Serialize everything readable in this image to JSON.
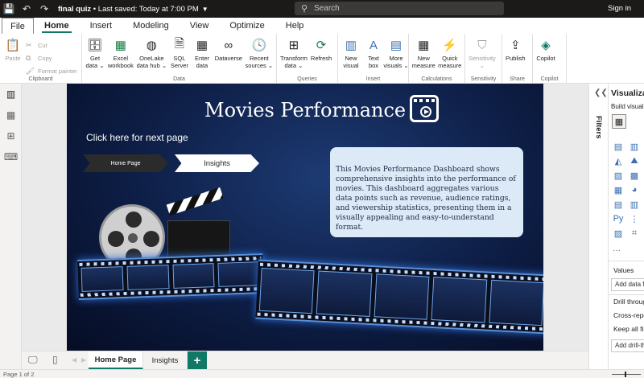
{
  "titlebar": {
    "file_name": "final quiz",
    "save_status": "Last saved: Today at 7:00 PM",
    "search_placeholder": "Search",
    "signin": "Sign in"
  },
  "menu": {
    "file": "File",
    "tabs": [
      "Home",
      "Insert",
      "Modeling",
      "View",
      "Optimize",
      "Help"
    ],
    "active_tab": "Home"
  },
  "ribbon": {
    "clipboard": {
      "label": "Clipboard",
      "paste": "Paste",
      "cut": "Cut",
      "copy": "Copy",
      "format_painter": "Format painter"
    },
    "data": {
      "label": "Data",
      "get_data": [
        "Get",
        "data ⌄"
      ],
      "excel": [
        "Excel",
        "workbook"
      ],
      "onelake": [
        "OneLake",
        "data hub ⌄"
      ],
      "sql": [
        "SQL",
        "Server"
      ],
      "enter": [
        "Enter",
        "data"
      ],
      "dataverse": [
        "Dataverse",
        ""
      ],
      "recent": [
        "Recent",
        "sources ⌄"
      ]
    },
    "queries": {
      "label": "Queries",
      "transform": [
        "Transform",
        "data ⌄"
      ],
      "refresh": [
        "Refresh",
        ""
      ]
    },
    "insert": {
      "label": "Insert",
      "new_visual": [
        "New",
        "visual"
      ],
      "text_box": [
        "Text",
        "box"
      ],
      "more_visuals": [
        "More",
        "visuals ⌄"
      ]
    },
    "calculations": {
      "label": "Calculations",
      "new_measure": [
        "New",
        "measure"
      ],
      "quick_measure": [
        "Quick",
        "measure"
      ]
    },
    "sensitivity": {
      "label": "Sensitivity",
      "btn": [
        "Sensitivity",
        "⌄"
      ]
    },
    "share": {
      "label": "Share",
      "publish": [
        "Publish",
        ""
      ]
    },
    "copilot": {
      "label": "Copilot",
      "btn": [
        "Copilot",
        ""
      ]
    }
  },
  "report": {
    "title": "Movies Performance",
    "next_page_text": "Click here for next page",
    "home_button": "Home Page",
    "insights_button": "Insights",
    "description": "This Movies Performance Dashboard shows comprehensive insights into the performance of movies. This dashboard aggregates various data points such as  revenue, audience ratings, and viewership statistics, presenting them in a visually appealing and easy-to-understand format."
  },
  "panes": {
    "filters": "Filters",
    "visualizations_title": "Visualizations",
    "build_visual": "Build visual",
    "more": "···",
    "values": "Values",
    "add_data_fields": "Add data fields here",
    "drill_through": "Drill through",
    "cross_report": "Cross-report",
    "keep_all_filters": "Keep all filters",
    "add_drill": "Add drill-through fields here"
  },
  "pages": {
    "tabs": [
      "Home Page",
      "Insights"
    ],
    "active": "Home Page",
    "add": "+"
  },
  "status": {
    "page_indicator": "Page 1 of 2"
  },
  "colors": {
    "accent": "#117865",
    "titlebar": "#1b1a19",
    "report_bg": "#0d1d44",
    "card_bg": "#dce9f7"
  },
  "icons": {
    "save": "💾",
    "undo": "↶",
    "redo": "↷",
    "search": "⚲",
    "visual_icons": [
      "▤",
      "▥",
      "▦",
      "◭",
      "⛰",
      "▧",
      "▨",
      "▩",
      "◰",
      "▦",
      "◕",
      "▣",
      "▤",
      "▥",
      "◫",
      "Py",
      "⋮",
      "▦",
      "▨",
      "⌗",
      "◰"
    ]
  }
}
